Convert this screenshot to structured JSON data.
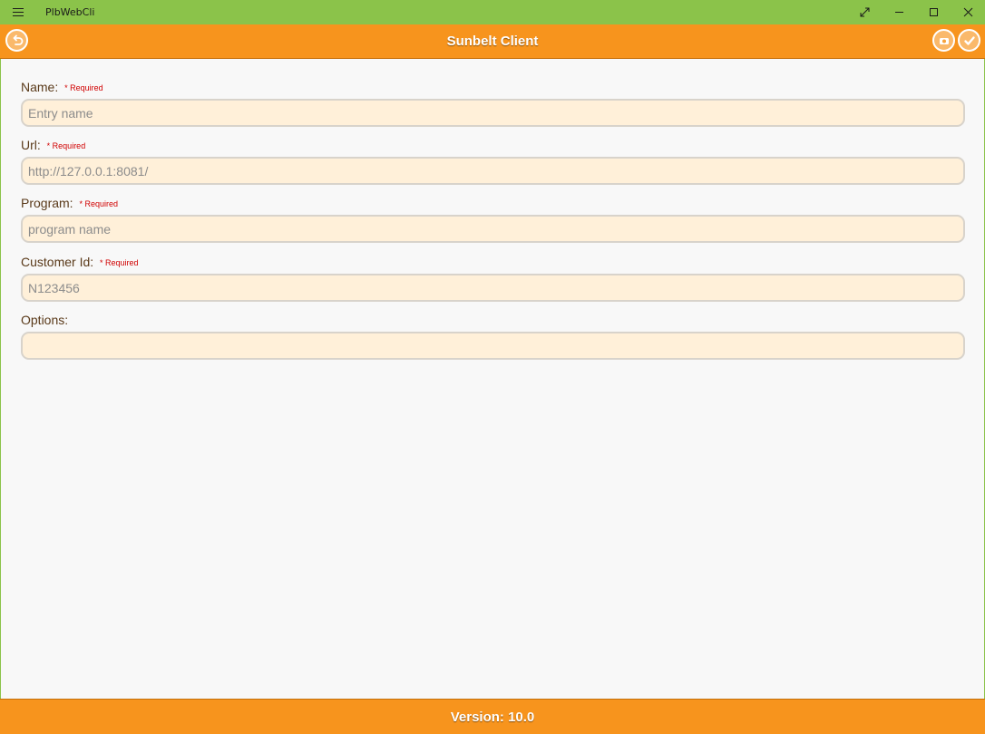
{
  "window": {
    "app_name": "PlbWebCli",
    "controls": [
      "expand-icon",
      "minimize-icon",
      "maximize-icon",
      "close-icon"
    ]
  },
  "appbar": {
    "title": "Sunbelt Client",
    "left_icon": "back-icon",
    "right_icons": [
      "camera-icon",
      "check-icon"
    ]
  },
  "form": {
    "required_text": "* Required",
    "name": {
      "label": "Name:",
      "placeholder": "Entry name",
      "value": ""
    },
    "url": {
      "label": "Url:",
      "placeholder": "http://127.0.0.1:8081/",
      "value": ""
    },
    "program": {
      "label": "Program:",
      "placeholder": "program name",
      "value": ""
    },
    "customer_id": {
      "label": "Customer Id:",
      "placeholder": "N123456",
      "value": ""
    },
    "options": {
      "label": "Options:",
      "placeholder": "",
      "value": ""
    }
  },
  "footer": {
    "version": "Version: 10.0"
  },
  "colors": {
    "titlebar": "#8bc34a",
    "accent": "#f7941d",
    "input_bg": "#fff0d9",
    "required": "#d00000",
    "label": "#5a3a1a"
  }
}
